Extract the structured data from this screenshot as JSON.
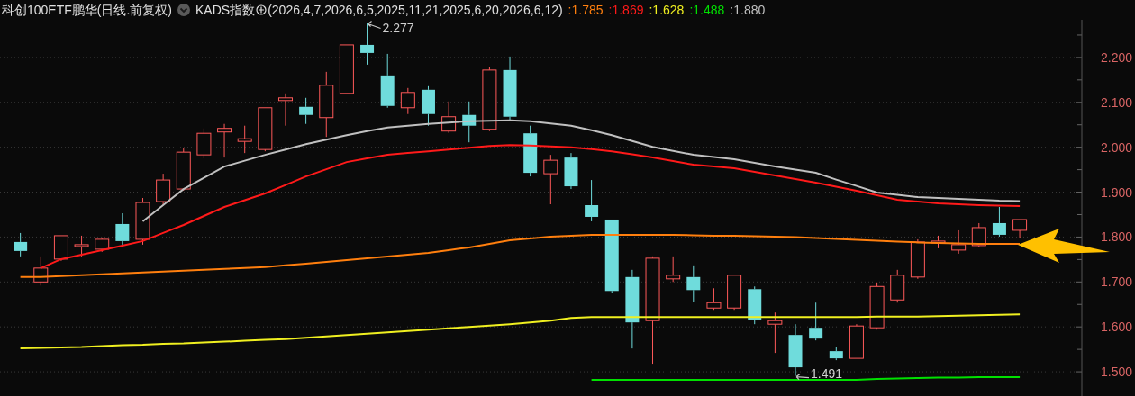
{
  "header": {
    "title": "科创100ETF鹏华(日线.前复权)",
    "indicator": "KADS指数",
    "params": "(2026,4,7,2026,6,5,2025,11,21,2025,6,20,2026,6,12)",
    "readings": [
      {
        "text": ":1.785",
        "color": "#ff7f0e"
      },
      {
        "text": ":1.869",
        "color": "#ff1a1a"
      },
      {
        "text": ":1.628",
        "color": "#f0f020"
      },
      {
        "text": ":1.488",
        "color": "#00e000"
      },
      {
        "text": ":1.880",
        "color": "#c0c0c0"
      }
    ]
  },
  "chart": {
    "chart_data": {
      "type": "candlestick",
      "grid": true,
      "ylim": [
        1.446,
        2.284
      ],
      "ohlc": [
        [
          1.789,
          1.809,
          1.757,
          1.769
        ],
        [
          1.7,
          1.757,
          1.692,
          1.731
        ],
        [
          1.751,
          1.803,
          1.747,
          1.803
        ],
        [
          1.779,
          1.803,
          1.757,
          1.783
        ],
        [
          1.773,
          1.799,
          1.767,
          1.795
        ],
        [
          1.829,
          1.853,
          1.783,
          1.791
        ],
        [
          1.795,
          1.887,
          1.783,
          1.877
        ],
        [
          1.879,
          1.941,
          1.871,
          1.927
        ],
        [
          1.907,
          1.999,
          1.903,
          1.989
        ],
        [
          1.983,
          2.042,
          1.975,
          2.031
        ],
        [
          2.034,
          2.052,
          1.977,
          2.042
        ],
        [
          2.013,
          2.048,
          1.987,
          2.019
        ],
        [
          1.995,
          2.088,
          1.991,
          2.088
        ],
        [
          2.104,
          2.12,
          2.048,
          2.11
        ],
        [
          2.09,
          2.11,
          2.052,
          2.072
        ],
        [
          2.066,
          2.168,
          2.023,
          2.138
        ],
        [
          2.12,
          2.228,
          2.12,
          2.228
        ],
        [
          2.228,
          2.277,
          2.184,
          2.21
        ],
        [
          2.16,
          2.208,
          2.088,
          2.092
        ],
        [
          2.088,
          2.132,
          2.074,
          2.122
        ],
        [
          2.128,
          2.136,
          2.048,
          2.074
        ],
        [
          2.036,
          2.102,
          2.032,
          2.068
        ],
        [
          2.072,
          2.102,
          2.011,
          2.048
        ],
        [
          2.04,
          2.178,
          2.036,
          2.172
        ],
        [
          2.172,
          2.202,
          2.058,
          2.068
        ],
        [
          2.031,
          2.048,
          1.935,
          1.943
        ],
        [
          1.941,
          1.983,
          1.873,
          1.971
        ],
        [
          1.977,
          1.987,
          1.907,
          1.913
        ],
        [
          1.871,
          1.927,
          1.835,
          1.845
        ],
        [
          1.839,
          1.839,
          1.676,
          1.68
        ],
        [
          1.711,
          1.727,
          1.552,
          1.61
        ],
        [
          1.614,
          1.757,
          1.518,
          1.753
        ],
        [
          1.707,
          1.757,
          1.7,
          1.715
        ],
        [
          1.711,
          1.737,
          1.656,
          1.682
        ],
        [
          1.642,
          1.686,
          1.638,
          1.654
        ],
        [
          1.642,
          1.715,
          1.638,
          1.715
        ],
        [
          1.684,
          1.69,
          1.606,
          1.616
        ],
        [
          1.606,
          1.632,
          1.542,
          1.614
        ],
        [
          1.582,
          1.606,
          1.491,
          1.51
        ],
        [
          1.598,
          1.654,
          1.57,
          1.574
        ],
        [
          1.546,
          1.556,
          1.526,
          1.53
        ],
        [
          1.53,
          1.606,
          1.53,
          1.602
        ],
        [
          1.598,
          1.699,
          1.594,
          1.69
        ],
        [
          1.66,
          1.727,
          1.654,
          1.715
        ],
        [
          1.711,
          1.795,
          1.707,
          1.789
        ],
        [
          1.787,
          1.803,
          1.775,
          1.791
        ],
        [
          1.771,
          1.815,
          1.763,
          1.783
        ],
        [
          1.781,
          1.831,
          1.777,
          1.821
        ],
        [
          1.831,
          1.867,
          1.801,
          1.805
        ],
        [
          1.815,
          1.839,
          1.797,
          1.839
        ]
      ],
      "yticks": [
        {
          "value": 1.5,
          "label": "1.500"
        },
        {
          "value": 1.6,
          "label": "1.600"
        },
        {
          "value": 1.7,
          "label": "1.700"
        },
        {
          "value": 1.8,
          "label": "1.800"
        },
        {
          "value": 1.9,
          "label": "1.900"
        },
        {
          "value": 2.0,
          "label": "2.000"
        },
        {
          "value": 2.1,
          "label": "2.100"
        },
        {
          "value": 2.2,
          "label": "2.200"
        }
      ],
      "categories": [
        null,
        null,
        null,
        null,
        null,
        null,
        null,
        null,
        null,
        null,
        null,
        null,
        null,
        null,
        null,
        null,
        null,
        null,
        null,
        null,
        null,
        null,
        null,
        null,
        null,
        null,
        null,
        null,
        null,
        null,
        null,
        null,
        null,
        null,
        null,
        null,
        null,
        null,
        null,
        null,
        null,
        null,
        null,
        null,
        null,
        null,
        null,
        null,
        null,
        null
      ],
      "series": [
        {
          "type": "line",
          "color": "#ff7f0e",
          "values": [
            1.711,
            1.711,
            1.713,
            1.715,
            1.717,
            1.719,
            1.721,
            1.723,
            1.725,
            1.727,
            1.729,
            1.731,
            1.733,
            1.737,
            1.741,
            1.745,
            1.749,
            1.753,
            1.757,
            1.761,
            1.765,
            1.771,
            1.777,
            1.785,
            1.793,
            1.797,
            1.801,
            1.803,
            1.805,
            1.805,
            1.805,
            1.805,
            1.805,
            1.804,
            1.803,
            1.803,
            1.802,
            1.801,
            1.8,
            1.798,
            1.796,
            1.794,
            1.792,
            1.79,
            1.788,
            1.787,
            1.786,
            1.785,
            1.785,
            1.785
          ]
        },
        {
          "type": "line",
          "color": "#ff1a1a",
          "values": [
            null,
            1.731,
            1.751,
            1.761,
            1.771,
            1.781,
            1.791,
            1.809,
            1.827,
            1.847,
            1.867,
            1.882,
            1.897,
            1.916,
            1.935,
            1.951,
            1.967,
            1.975,
            1.983,
            1.987,
            1.991,
            1.995,
            1.999,
            2.003,
            2.005,
            2.004,
            2.002,
            2.0,
            1.996,
            1.991,
            1.984,
            1.977,
            1.969,
            1.961,
            1.957,
            1.953,
            1.945,
            1.937,
            1.929,
            1.921,
            1.912,
            1.903,
            1.893,
            1.883,
            1.879,
            1.875,
            1.873,
            1.871,
            1.87,
            1.869
          ]
        },
        {
          "type": "line",
          "color": "#f0f020",
          "values": [
            1.552,
            1.553,
            1.554,
            1.555,
            1.557,
            1.559,
            1.56,
            1.562,
            1.563,
            1.565,
            1.567,
            1.569,
            1.571,
            1.573,
            1.576,
            1.579,
            1.582,
            1.585,
            1.588,
            1.591,
            1.594,
            1.597,
            1.6,
            1.603,
            1.606,
            1.61,
            1.614,
            1.62,
            1.622,
            1.622,
            1.622,
            1.622,
            1.622,
            1.622,
            1.622,
            1.622,
            1.622,
            1.622,
            1.622,
            1.622,
            1.622,
            1.622,
            1.623,
            1.623,
            1.623,
            1.624,
            1.625,
            1.626,
            1.627,
            1.628
          ]
        },
        {
          "type": "line",
          "color": "#00e000",
          "values": [
            null,
            null,
            null,
            null,
            null,
            null,
            null,
            null,
            null,
            null,
            null,
            null,
            null,
            null,
            null,
            null,
            null,
            null,
            null,
            null,
            null,
            null,
            null,
            null,
            null,
            null,
            null,
            null,
            1.482,
            1.482,
            1.482,
            1.482,
            1.482,
            1.482,
            1.482,
            1.482,
            1.482,
            1.482,
            1.482,
            1.482,
            1.482,
            1.482,
            1.484,
            1.485,
            1.486,
            1.487,
            1.487,
            1.488,
            1.488,
            1.488
          ]
        },
        {
          "type": "line",
          "color": "#c0c0c0",
          "values": [
            null,
            null,
            null,
            null,
            null,
            null,
            1.835,
            1.871,
            1.907,
            1.932,
            1.957,
            1.97,
            1.983,
            1.995,
            2.007,
            2.017,
            2.027,
            2.036,
            2.044,
            2.048,
            2.052,
            2.055,
            2.058,
            2.059,
            2.06,
            2.058,
            2.053,
            2.048,
            2.038,
            2.027,
            2.014,
            2.001,
            1.992,
            1.983,
            1.978,
            1.973,
            1.965,
            1.957,
            1.95,
            1.943,
            1.928,
            1.914,
            1.899,
            1.894,
            1.889,
            1.887,
            1.885,
            1.883,
            1.881,
            1.88
          ]
        }
      ],
      "annotations": [
        {
          "text": "2.277"
        },
        {
          "text": "1.491"
        }
      ]
    }
  }
}
